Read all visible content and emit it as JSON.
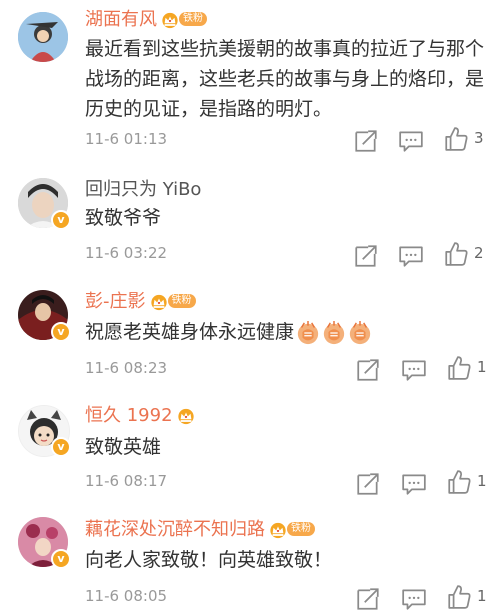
{
  "comments": [
    {
      "user": "湖面有风",
      "badge": "铁粉",
      "text": "最近看到这些抗美援朝的故事真的拉近了与那个战场的距离，这些老兵的故事与身上的烙印，是历史的见证，是指路的明灯。",
      "time": "11-6 01:13",
      "likes": "3"
    },
    {
      "user": "回归只为 YiBo",
      "text": "致敬爷爷",
      "time": "11-6 03:22",
      "likes": "2"
    },
    {
      "user": "彭-庄影",
      "badge": "铁粉",
      "text": "祝愿老英雄身体永远健康",
      "time": "11-6 08:23",
      "likes": "1"
    },
    {
      "user": "恒久 1992",
      "text": "致敬英雄",
      "time": "11-6 08:17",
      "likes": "1"
    },
    {
      "user": "藕花深处沉醉不知归路",
      "badge": "铁粉",
      "text": "向老人家致敬！向英雄致敬！",
      "time": "11-6 08:05",
      "likes": "1"
    }
  ],
  "colors": {
    "name_orange": "#eb7350",
    "vip_badge": "#f5a623",
    "fan_badge": "#f7a84a"
  },
  "icons": [
    "repost-icon",
    "comment-icon",
    "like-icon",
    "crown-icon",
    "verified-badge-icon",
    "clap-emoji-icon"
  ]
}
